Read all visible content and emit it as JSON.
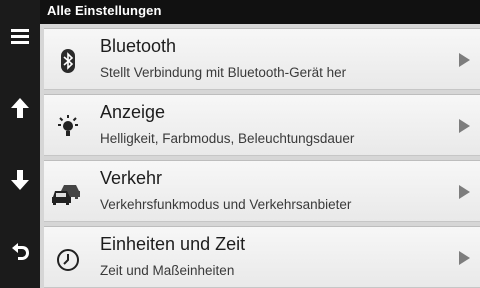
{
  "header": {
    "title": "Alle Einstellungen"
  },
  "sidebar": {
    "buttons": [
      {
        "icon": "menu-icon"
      },
      {
        "icon": "arrow-up-icon"
      },
      {
        "icon": "arrow-down-icon"
      },
      {
        "icon": "back-icon"
      }
    ]
  },
  "settings": {
    "items": [
      {
        "title": "Bluetooth",
        "subtitle": "Stellt Verbindung mit Bluetooth-Gerät her",
        "icon": "bluetooth-icon"
      },
      {
        "title": "Anzeige",
        "subtitle": "Helligkeit, Farbmodus, Beleuchtungsdauer",
        "icon": "brightness-icon"
      },
      {
        "title": "Verkehr",
        "subtitle": "Verkehrsfunkmodus und Verkehrsanbieter",
        "icon": "traffic-icon"
      },
      {
        "title": "Einheiten und Zeit",
        "subtitle": "Zeit und Maßeinheiten",
        "icon": "clock-icon"
      }
    ]
  },
  "colors": {
    "background": "#d6d6d6",
    "title_bar": "#111111",
    "sidebar": "#1b1b1b",
    "chevron": "#7d7d7d"
  }
}
